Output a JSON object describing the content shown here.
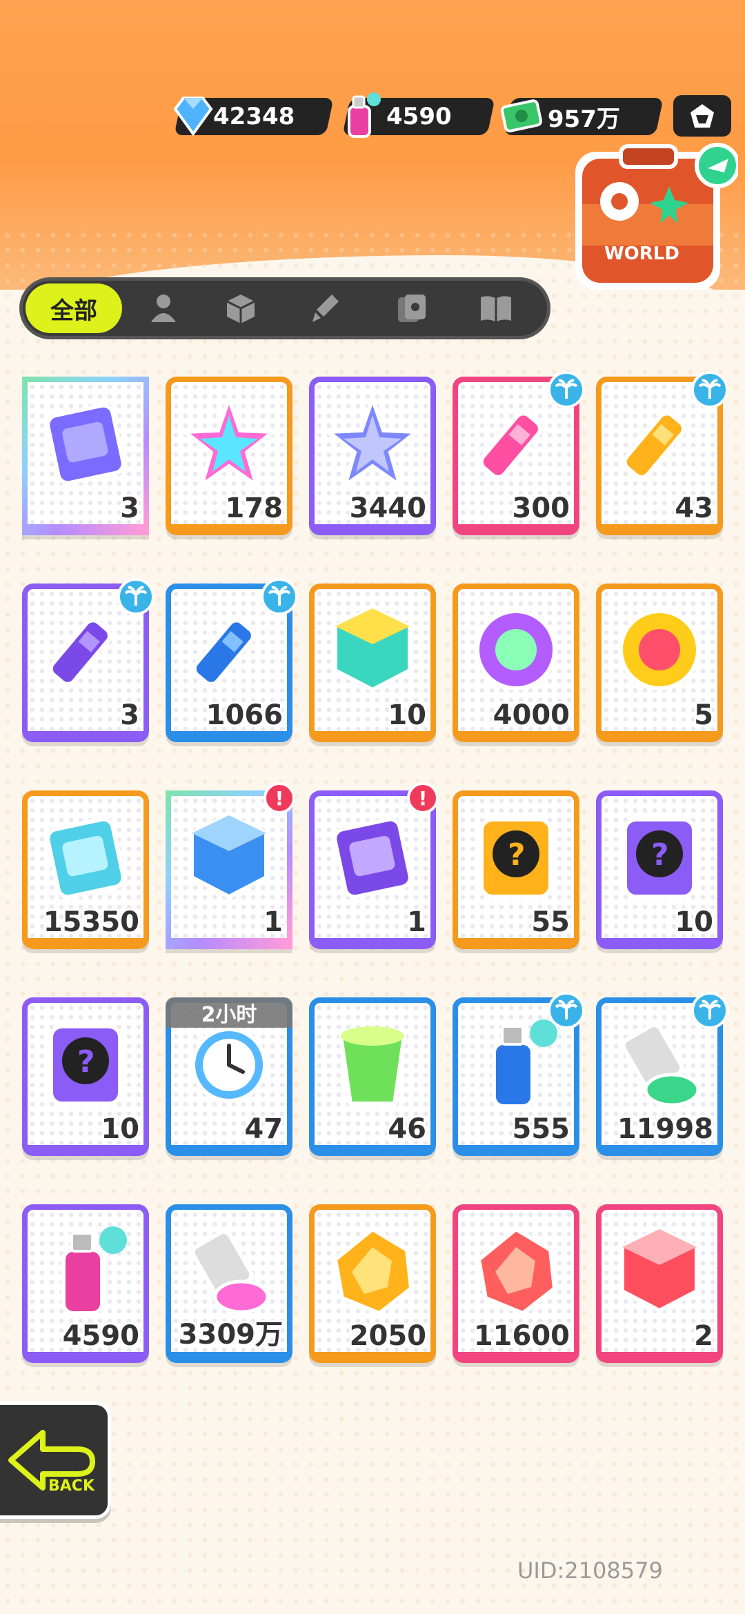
{
  "currency": {
    "diamond": "42348",
    "spray": "4590",
    "cash": "957万"
  },
  "tabs": {
    "all_label": "全部"
  },
  "suitcase_label": "WORLD",
  "items": [
    {
      "count": "3",
      "border": "rainbow",
      "icon": "ticket-icon"
    },
    {
      "count": "178",
      "border": "orange",
      "icon": "rainbow-star-icon"
    },
    {
      "count": "3440",
      "border": "purple",
      "icon": "blue-star-icon"
    },
    {
      "count": "300",
      "border": "pink",
      "icon": "pink-crayon-icon",
      "badge": "palm"
    },
    {
      "count": "43",
      "border": "orange",
      "icon": "yellow-crayon-icon",
      "badge": "palm"
    },
    {
      "count": "3",
      "border": "purple",
      "icon": "purple-crayon-icon",
      "badge": "palm"
    },
    {
      "count": "1066",
      "border": "blue",
      "icon": "blue-crayon-icon",
      "badge": "palm"
    },
    {
      "count": "10",
      "border": "orange",
      "icon": "color-block-icon"
    },
    {
      "count": "4000",
      "border": "orange",
      "icon": "cool-badge-icon"
    },
    {
      "count": "5",
      "border": "orange",
      "icon": "star-burst-icon"
    },
    {
      "count": "15350",
      "border": "orange",
      "icon": "season-ticket-icon"
    },
    {
      "count": "1",
      "border": "rainbow",
      "icon": "deity-box-icon",
      "badge": "alert"
    },
    {
      "count": "1",
      "border": "purple",
      "icon": "travel-card-icon",
      "badge": "alert"
    },
    {
      "count": "55",
      "border": "orange",
      "icon": "deity-mystery-gold-icon"
    },
    {
      "count": "10",
      "border": "purple",
      "icon": "deity-mystery-purple-icon"
    },
    {
      "count": "10",
      "border": "purple",
      "icon": "travel-mystery-card-icon"
    },
    {
      "count": "47",
      "border": "blue",
      "icon": "alarm-clock-icon",
      "timer": "2小时"
    },
    {
      "count": "46",
      "border": "blue",
      "icon": "green-cup-icon"
    },
    {
      "count": "555",
      "border": "blue",
      "icon": "spray-can-icon",
      "badge": "palm"
    },
    {
      "count": "11998",
      "border": "blue",
      "icon": "paint-tube-icon",
      "badge": "palm"
    },
    {
      "count": "4590",
      "border": "purple",
      "icon": "pink-spray-icon"
    },
    {
      "count": "3309万",
      "border": "blue",
      "icon": "rainbow-paint-icon"
    },
    {
      "count": "2050",
      "border": "orange",
      "icon": "gold-crystal-icon"
    },
    {
      "count": "11600",
      "border": "pink",
      "icon": "red-crystal-icon"
    },
    {
      "count": "2",
      "border": "pink",
      "icon": "red-cube-icon"
    }
  ],
  "back_label": "BACK",
  "uid": "UID:2108579",
  "colors": {
    "accent": "#ddf21a",
    "orange": "#f59a1c",
    "purple": "#8b5cf6",
    "pink": "#f0457f",
    "blue": "#2b8fe8"
  }
}
